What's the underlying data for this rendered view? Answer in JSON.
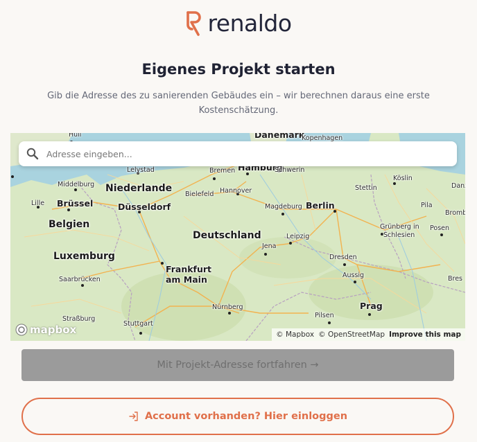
{
  "brand": {
    "name": "renaldo",
    "accent": "#e0704a"
  },
  "heading": {
    "title": "Eigenes Projekt starten",
    "subtitle": "Gib die Adresse des zu sanierenden Gebäudes ein – wir berechnen daraus eine erste Kostenschätzung."
  },
  "search": {
    "placeholder": "Adresse eingeben...",
    "value": "",
    "icon": "search-icon"
  },
  "map": {
    "labels": {
      "hull": "Hull",
      "danemark": "Danemark",
      "kopenhagen": "Kopenhagen",
      "lelystad": "Lelystad",
      "bremen": "Bremen",
      "hamburg": "Hamburg",
      "schwerin": "Schwerin",
      "koslin": "Köslin",
      "danz": "Danz",
      "middelburg": "Middelburg",
      "niederlande": "Niederlande",
      "hannover": "Hannover",
      "stettin": "Stettin",
      "lille": "Lille",
      "brussel": "Brüssel",
      "dusseldorf": "Düsseldorf",
      "bielefeld": "Bielefeld",
      "magdeburg": "Magdeburg",
      "berlin": "Berlin",
      "pila": "Pila",
      "bromb": "Bromb",
      "belgien": "Belgien",
      "grunberg1": "Grünberg in",
      "grunberg2": "Schlesien",
      "posen": "Posen",
      "deutschland": "Deutschland",
      "leipzig": "Leipzig",
      "jena": "Jena",
      "luxemburg": "Luxemburg",
      "dresden": "Dresden",
      "frankfurt1": "Frankfurt",
      "frankfurt2": "am Main",
      "saarbrucken": "Saarbrücken",
      "aussig": "Aussig",
      "bres": "Bres",
      "prag": "Prag",
      "nurnberg": "Nürnberg",
      "pilsen": "Pilsen",
      "strassburg": "Straßburg",
      "stuttgart": "Stuttgart"
    },
    "logo_text": "mapbox",
    "attribution": {
      "mapbox": "© Mapbox",
      "osm": "© OpenStreetMap",
      "improve": "Improve this map"
    }
  },
  "actions": {
    "continue_label": "Mit Projekt-Adresse fortfahren →",
    "login_label": "Account vorhanden? Hier einloggen"
  }
}
